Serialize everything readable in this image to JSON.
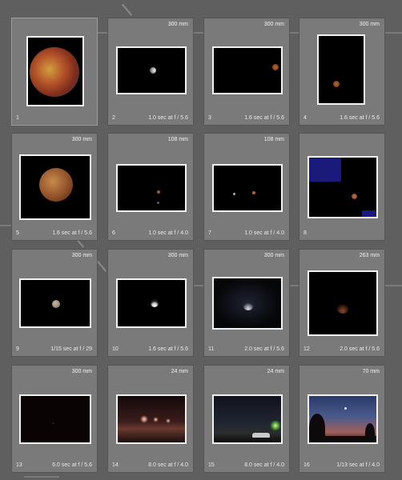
{
  "photos": [
    {
      "index": "1",
      "focal": "",
      "exposure": ""
    },
    {
      "index": "2",
      "focal": "300 mm",
      "exposure": "1.0 sec at f / 5.6"
    },
    {
      "index": "3",
      "focal": "300 mm",
      "exposure": "1.6 sec at f / 5.6"
    },
    {
      "index": "4",
      "focal": "300 mm",
      "exposure": "1.6 sec at f / 5.6"
    },
    {
      "index": "5",
      "focal": "300 mm",
      "exposure": "1.6 sec at f / 5.6"
    },
    {
      "index": "6",
      "focal": "108 mm",
      "exposure": "1.0 sec at f / 4.0"
    },
    {
      "index": "7",
      "focal": "108 mm",
      "exposure": "1.0 sec at f / 4.0"
    },
    {
      "index": "8",
      "focal": "",
      "exposure": ""
    },
    {
      "index": "9",
      "focal": "300 mm",
      "exposure": "1/15 sec at f / 29"
    },
    {
      "index": "10",
      "focal": "300 mm",
      "exposure": "1.6 sec at f / 5.6"
    },
    {
      "index": "11",
      "focal": "300 mm",
      "exposure": "2.0 sec at f / 5.6"
    },
    {
      "index": "12",
      "focal": "263 mm",
      "exposure": "2.0 sec at f / 5.6"
    },
    {
      "index": "13",
      "focal": "300 mm",
      "exposure": "6.0 sec at f / 5.6"
    },
    {
      "index": "14",
      "focal": "24 mm",
      "exposure": "8.0 sec at f / 4.0"
    },
    {
      "index": "15",
      "focal": "24 mm",
      "exposure": "8.0 sec at f / 4.0"
    },
    {
      "index": "16",
      "focal": "70 mm",
      "exposure": "1/13 sec at f / 4.0"
    }
  ],
  "colors": {
    "grid_background": "#5f5f5f",
    "cell_background": "#7a7a7a",
    "photo_border": "#f2f2f2",
    "text": "#eaeaea"
  }
}
